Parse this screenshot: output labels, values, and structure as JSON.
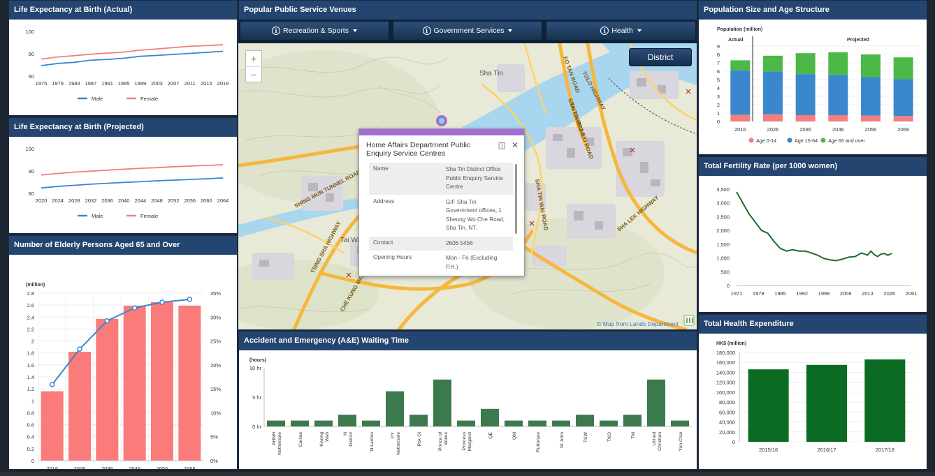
{
  "colors": {
    "male": "#3a87cd",
    "female": "#f07f7f",
    "bar_red": "#fb7a7a",
    "line_blue": "#3a87cd",
    "green_dark": "#3c7a4d",
    "green_health": "#0b6b23",
    "fertility": "#1f6b2a",
    "age_0_14": "#f07f7f",
    "age_15_64": "#3a87cd",
    "age_65": "#4cb848"
  },
  "panels": {
    "life_actual": {
      "title": "Life Expectancy at Birth (Actual)"
    },
    "life_projected": {
      "title": "Life Expectancy at Birth (Projected)"
    },
    "elderly": {
      "title": "Number of Elderly Persons Aged 65 and Over",
      "unit": "(million)"
    },
    "venues": {
      "title": "Popular Public Service Venues"
    },
    "ae": {
      "title": "Accident and Emergency (A&E) Waiting Time",
      "unit": "(hours)"
    },
    "population": {
      "title": "Population Size and Age Structure",
      "unit": "Population (million)",
      "actual_label": "Actual",
      "projected_label": "Projected"
    },
    "fertility": {
      "title": "Total Fertility Rate (per 1000 women)"
    },
    "health": {
      "title": "Total Health Expenditure",
      "unit": "HK$ (million)"
    }
  },
  "venues": {
    "categories": [
      {
        "label": "Recreation & Sports",
        "icon": "info-icon"
      },
      {
        "label": "Government Services",
        "icon": "info-icon"
      },
      {
        "label": "Health",
        "icon": "info-icon"
      }
    ],
    "district_button": "District",
    "zoom_in": "+",
    "zoom_out": "−",
    "map_labels": [
      "Sha Tin",
      "Tai Wai",
      "SHING MUN TUNNEL ROAD",
      "TAI CHUNG KIU ROAD",
      "SHA TIN WAI ROAD",
      "TOLO HIGHWAY",
      "FO TAN ROAD",
      "SHA LEK HIGHWAY",
      "CHE KUNG MIU ROAD",
      "TSING SHA HIGHWAY",
      "SHA TIN ROAD"
    ],
    "credit": "© Map from Lands Department",
    "popup": {
      "title": "Home Affairs Department Public Enquiry Service Centres",
      "rows": [
        {
          "key": "Name",
          "value": "Sha Tin District Office Public Enquiry Service Centre"
        },
        {
          "key": "Address",
          "value": "G/F Sha Tin Government offices, 1 Sheung Wo Che Road, Sha Tin, NT."
        },
        {
          "key": "Contact",
          "value": "2606 5456"
        },
        {
          "key": "Opening Hours",
          "value": "Mon - Fri (Excluding P.H.)"
        }
      ]
    }
  },
  "chart_data": [
    {
      "id": "life_actual",
      "type": "line",
      "x": [
        1975,
        1979,
        1983,
        1987,
        1991,
        1995,
        1999,
        2003,
        2007,
        2011,
        2015,
        2019
      ],
      "ylim": [
        60,
        100
      ],
      "yticks": [
        60,
        80,
        100
      ],
      "series": [
        {
          "name": "Male",
          "values": [
            69.4,
            71.3,
            72.3,
            74.2,
            74.9,
            76.0,
            77.7,
            78.5,
            79.4,
            80.3,
            81.2,
            82.2
          ]
        },
        {
          "name": "Female",
          "values": [
            75.2,
            77.1,
            78.3,
            79.6,
            80.5,
            81.5,
            83.2,
            84.3,
            85.5,
            86.7,
            87.3,
            88.1
          ]
        }
      ]
    },
    {
      "id": "life_projected",
      "type": "line",
      "x": [
        2020,
        2024,
        2028,
        2032,
        2036,
        2040,
        2044,
        2048,
        2052,
        2056,
        2060,
        2064
      ],
      "ylim": [
        80,
        100
      ],
      "yticks": [
        80,
        90,
        100
      ],
      "series": [
        {
          "name": "Male",
          "values": [
            82.4,
            83.1,
            83.6,
            84.1,
            84.5,
            84.9,
            85.2,
            85.6,
            85.9,
            86.2,
            86.5,
            86.9
          ]
        },
        {
          "name": "Female",
          "values": [
            88.2,
            88.9,
            89.5,
            89.9,
            90.4,
            90.8,
            91.2,
            91.5,
            91.9,
            92.2,
            92.5,
            92.8
          ]
        }
      ]
    },
    {
      "id": "elderly",
      "type": "bar",
      "categories": [
        "2016",
        "2026",
        "2036",
        "2046",
        "2056",
        "2066"
      ],
      "values": [
        1.16,
        1.82,
        2.37,
        2.59,
        2.65,
        2.59
      ],
      "line_values": [
        15.9,
        23.3,
        29.2,
        31.9,
        33.1,
        33.7
      ],
      "ylim": [
        0,
        2.8
      ],
      "yticks": [
        0,
        0.2,
        0.4,
        0.6,
        0.8,
        1,
        1.2,
        1.4,
        1.6,
        1.8,
        2,
        2.2,
        2.4,
        2.6,
        2.8
      ],
      "y2lim": [
        0,
        35
      ],
      "y2ticks": [
        "0%",
        "5%",
        "10%",
        "15%",
        "20%",
        "25%",
        "30%",
        "35%"
      ]
    },
    {
      "id": "ae",
      "type": "bar",
      "categories": [
        "AHNH, Nethersole",
        "Caritas",
        "Kwong Wah",
        "N District",
        "N Lantau",
        "PY Nethersole",
        "Pok Oi",
        "Prince of Wales",
        "Princess Margaret",
        "QE",
        "QM",
        "Ruttonjee",
        "St John",
        "TSW",
        "TKO",
        "TM",
        "United Christian",
        "Yan Chai"
      ],
      "values": [
        1,
        1,
        1,
        2,
        1,
        6,
        2,
        8,
        1,
        3,
        1,
        1,
        1,
        2,
        1,
        2,
        8,
        1
      ],
      "ylim": [
        0,
        10
      ],
      "yticks": [
        "0 hr",
        "5 hr",
        "10 hr"
      ]
    },
    {
      "id": "population",
      "type": "bar",
      "categories": [
        "2016",
        "2026",
        "2036",
        "2046",
        "2056",
        "2066"
      ],
      "series": [
        {
          "name": "Age 0-14",
          "values": [
            0.8,
            0.85,
            0.75,
            0.75,
            0.7,
            0.65
          ]
        },
        {
          "name": "Age 15-64",
          "values": [
            5.3,
            5.1,
            4.9,
            4.8,
            4.6,
            4.4
          ]
        },
        {
          "name": "Age 65 and over",
          "values": [
            1.2,
            1.9,
            2.5,
            2.7,
            2.7,
            2.6
          ]
        }
      ],
      "ylim": [
        0,
        9
      ],
      "yticks": [
        0,
        1,
        2,
        3,
        4,
        5,
        6,
        7,
        8,
        9
      ]
    },
    {
      "id": "fertility",
      "type": "line",
      "xlim": [
        1971,
        2061
      ],
      "xticks": [
        1971,
        1978,
        1985,
        1992,
        1999,
        2006,
        2013,
        2026,
        2061
      ],
      "ylim": [
        0,
        3500
      ],
      "yticks": [
        "0",
        "500",
        "1,000",
        "1,500",
        "2,000",
        "2,500",
        "3,000",
        "3,500"
      ],
      "x": [
        1971,
        1973,
        1975,
        1977,
        1979,
        1981,
        1983,
        1985,
        1987,
        1989,
        1991,
        1993,
        1995,
        1997,
        1999,
        2001,
        2003,
        2005,
        2007,
        2009,
        2011,
        2013,
        2015,
        2017,
        2019,
        2021,
        2023,
        2025,
        2026,
        2027,
        2028,
        2029,
        2030
      ],
      "values": [
        3400,
        3000,
        2600,
        2300,
        2000,
        1900,
        1600,
        1350,
        1250,
        1300,
        1250,
        1250,
        1180,
        1100,
        980,
        930,
        900,
        960,
        1030,
        1050,
        1180,
        1100,
        1250,
        1120,
        1050,
        1140,
        1160,
        1100,
        1120,
        1140,
        1150,
        1155,
        1160
      ]
    },
    {
      "id": "health",
      "type": "bar",
      "categories": [
        "2015/16",
        "2016/17",
        "2017/18"
      ],
      "values": [
        146000,
        155000,
        166000
      ],
      "ylim": [
        0,
        180000
      ],
      "yticks": [
        "0",
        "20,000",
        "40,000",
        "60,000",
        "80,000",
        "100,000",
        "120,000",
        "140,000",
        "160,000",
        "180,000"
      ]
    }
  ]
}
